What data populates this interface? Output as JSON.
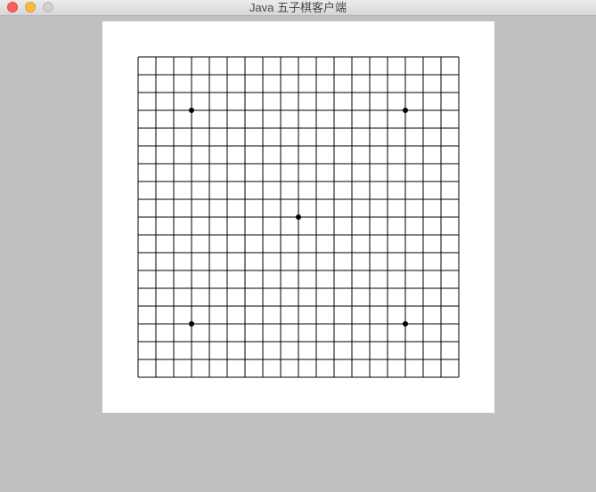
{
  "window": {
    "title": "Java 五子棋客户端",
    "controls": {
      "close_icon": "close-icon",
      "minimize_icon": "minimize-icon",
      "zoom_icon": "zoom-icon",
      "close_color": "#fc615d",
      "minimize_color": "#fdbc40",
      "zoom_color": "#d0d0d0"
    }
  },
  "board": {
    "lines": 19,
    "line_color": "#000000",
    "background": "#ffffff",
    "star_points": [
      [
        3,
        3
      ],
      [
        15,
        3
      ],
      [
        9,
        9
      ],
      [
        3,
        15
      ],
      [
        15,
        15
      ]
    ]
  }
}
